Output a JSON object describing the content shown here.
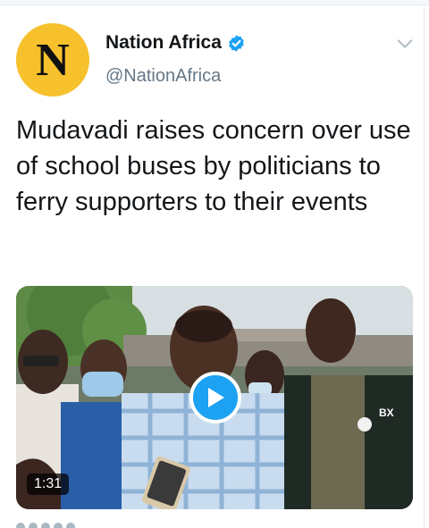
{
  "account": {
    "display_name": "Nation Africa",
    "handle": "@NationAfrica",
    "avatar_letter": "N",
    "verified": true,
    "avatar_color": "#f6c12c",
    "verified_color": "#1da1f2"
  },
  "tweet": {
    "text": "Mudavadi raises concern over use of school buses by politicians to ferry supporters to their events"
  },
  "media": {
    "type": "video",
    "duration": "1:31",
    "shirt_badge_text": "BX",
    "play_color": "#1da1f2"
  },
  "icons": {
    "menu": "chevron-down-icon",
    "verified": "verified-badge-icon",
    "play": "play-icon"
  }
}
